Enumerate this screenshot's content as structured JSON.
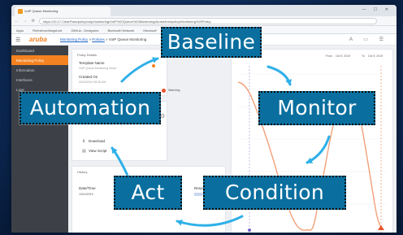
{
  "browser": {
    "tab_title": "VoIP Queue Monitoring",
    "url": "https://10.17.ClearPass/policy/voip/monitoring/VoIP%20Queue%20Monitoring/Aruba/test/policy/Monitoring%20Policy",
    "bookmarks": [
      "Apps",
      "Reference/blogshort",
      "GitHub - Designers",
      "Bluetooth Network",
      "Microsoft"
    ],
    "window_controls": "— ☐ ✕"
  },
  "app": {
    "logo": "aruba",
    "breadcrumb": {
      "link1": "Monitoring Policy",
      "sep": " » ",
      "link2": "Policies",
      "current": " » VoIP Queue Monitoring"
    },
    "header_icons": "A ▭ ☰"
  },
  "sidebar": {
    "items": [
      {
        "label": "Dashboard",
        "active": false
      },
      {
        "label": "Monitoring Policy",
        "active": true
      },
      {
        "label": "Information",
        "active": false
      },
      {
        "label": "Interfaces",
        "active": false
      },
      {
        "label": "Logs",
        "active": false
      }
    ]
  },
  "details": {
    "card_title": "Policy Details",
    "template_label": "Template Name",
    "template_value": "VoIP Queue Monitoring Script",
    "created_label": "Created On",
    "created_value": "09/18/2019 08:35 AM",
    "status_value": "Watching"
  },
  "actions": {
    "download_label": "Download",
    "view_label": "View Script"
  },
  "history": {
    "card_title": "History",
    "date_header": "Date/Time",
    "date_value": "10/10/2019",
    "result_header": "Result"
  },
  "chart": {
    "from_label": "From",
    "from_value": "Oct 9, 2019",
    "to_label": "To",
    "to_value": "Oct 9, 2019"
  },
  "callouts": {
    "baseline": "Baseline",
    "automation": "Automation",
    "monitor": "Monitor",
    "act": "Act",
    "condition": "Condition"
  },
  "colors": {
    "brand": "#f58220",
    "sidebar": "#3d4147",
    "callout_fill": "#0a6f9f",
    "arrow": "#2fb0e8",
    "chart_line": "#f2a07a"
  }
}
